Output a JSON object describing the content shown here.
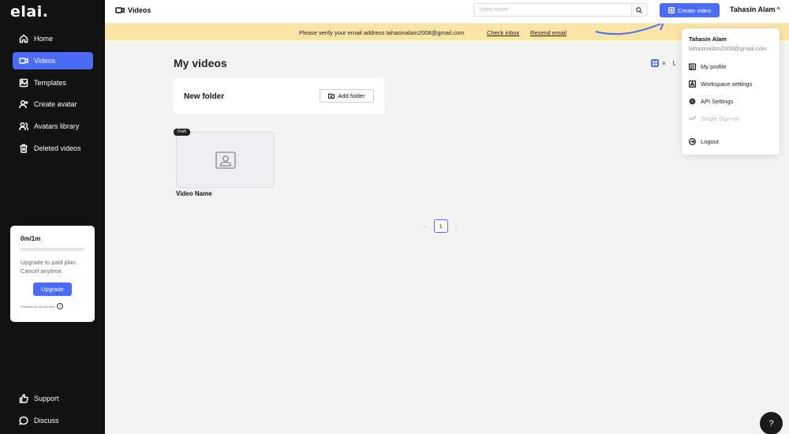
{
  "app": {
    "logo": "elai."
  },
  "sidebar": {
    "items": [
      {
        "label": "Home",
        "icon": "home-icon",
        "active": false
      },
      {
        "label": "Videos",
        "icon": "video-icon",
        "active": true
      },
      {
        "label": "Templates",
        "icon": "templates-icon",
        "active": false
      },
      {
        "label": "Create avatar",
        "icon": "create-avatar-icon",
        "active": false
      },
      {
        "label": "Avatars library",
        "icon": "avatars-library-icon",
        "active": false
      },
      {
        "label": "Deleted videos",
        "icon": "trash-icon",
        "active": false
      }
    ],
    "plan": {
      "usage": "0m/1m",
      "usage_fraction": 0,
      "line1": "Upgrade to paid plan.",
      "line2": "Cancel anytime.",
      "upgrade_label": "Upgrade",
      "note": "*minutes do not roll over"
    },
    "bottom": [
      {
        "label": "Support",
        "icon": "thumbs-up-icon"
      },
      {
        "label": "Discuss",
        "icon": "chat-icon"
      }
    ]
  },
  "topbar": {
    "page_label": "Videos",
    "search_placeholder": "Video name",
    "create_label": "Create video",
    "user_name": "Tahasin Alam",
    "chevron": "^"
  },
  "banner": {
    "message": "Please verify your email address tahasinalam2008@gmail.com",
    "check_inbox": "Check inbox",
    "resend": "Resend email"
  },
  "main": {
    "title": "My videos",
    "view_list_icon": "≡",
    "sort_label": "L",
    "folder": {
      "title": "New folder",
      "add_label": "Add folder"
    },
    "videos": [
      {
        "name": "Video Name",
        "status": "Draft"
      }
    ],
    "pagination": {
      "prev": "‹",
      "current": "1",
      "next": "›"
    }
  },
  "dropdown": {
    "name": "Tahasin Alam",
    "email": "tahasinalam2008@gmail.com",
    "items": [
      {
        "label": "My profile",
        "icon": "profile-icon",
        "enabled": true
      },
      {
        "label": "Workspace settings",
        "icon": "workspace-icon",
        "enabled": true
      },
      {
        "label": "API Settings",
        "icon": "gear-icon",
        "enabled": true
      },
      {
        "label": "Single Sign-on",
        "icon": "sso-icon",
        "enabled": false
      },
      {
        "label": "Logout",
        "icon": "logout-icon",
        "enabled": true
      }
    ]
  },
  "help": {
    "label": "?"
  },
  "colors": {
    "accent": "#4a6cf7",
    "sidebar": "#111111",
    "banner": "#fce4a6"
  }
}
